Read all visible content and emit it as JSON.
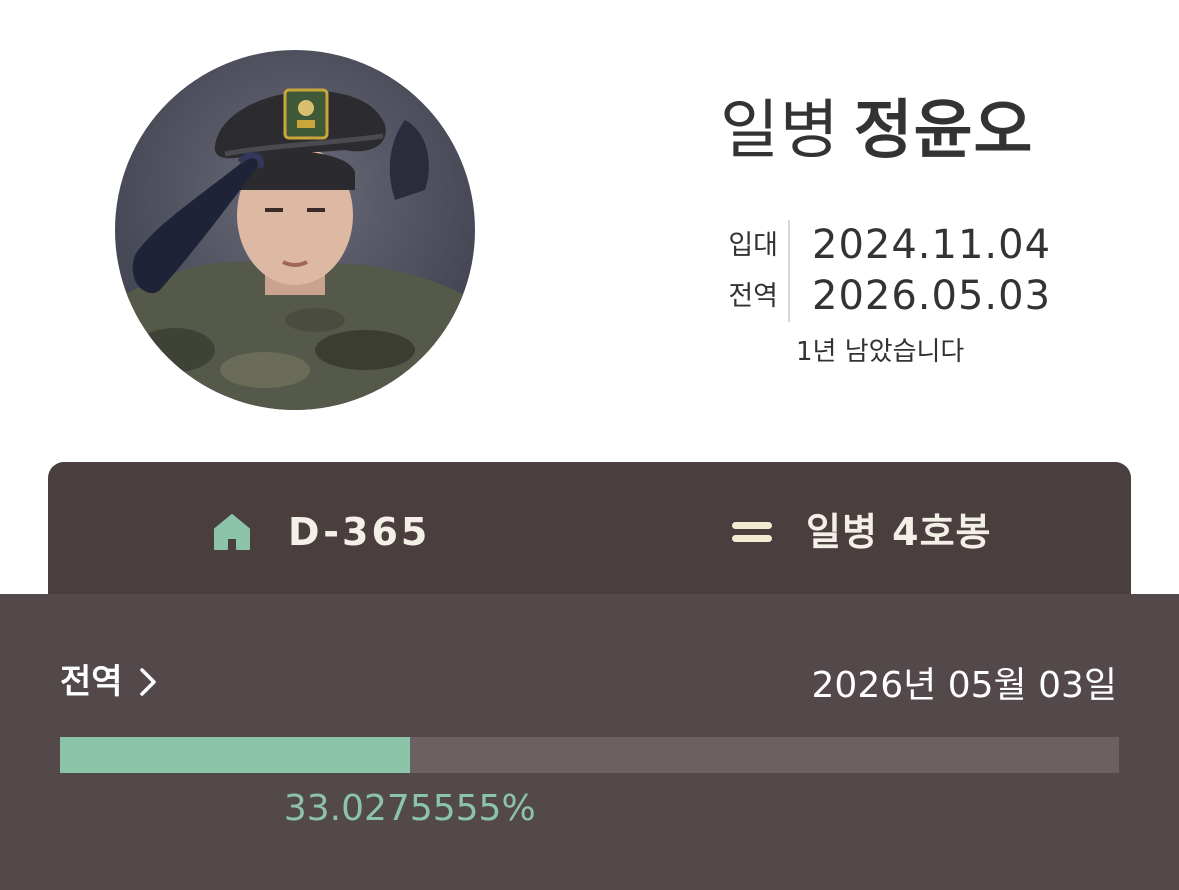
{
  "profile": {
    "rank": "일병",
    "name": "정윤오",
    "enlist_label": "입대",
    "enlist_date": "2024.11.04",
    "discharge_label": "전역",
    "discharge_date": "2026.05.03",
    "remaining_text": "1년 남았습니다"
  },
  "tabs": {
    "dday": {
      "icon": "home-icon",
      "label": "D-365"
    },
    "rank": {
      "icon": "equals-icon",
      "label": "일병 4호봉"
    }
  },
  "discharge_panel": {
    "title": "전역",
    "date_text": "2026년 05월 03일",
    "progress_percent": 33.0275555,
    "progress_text": "33.0275555%"
  },
  "colors": {
    "accent_green": "#8cc4aa",
    "tab_bar_bg": "#4a3e3e",
    "panel_bg": "#53494a",
    "progress_track": "#6b6162",
    "equals_icon": "#f4ecd2"
  }
}
